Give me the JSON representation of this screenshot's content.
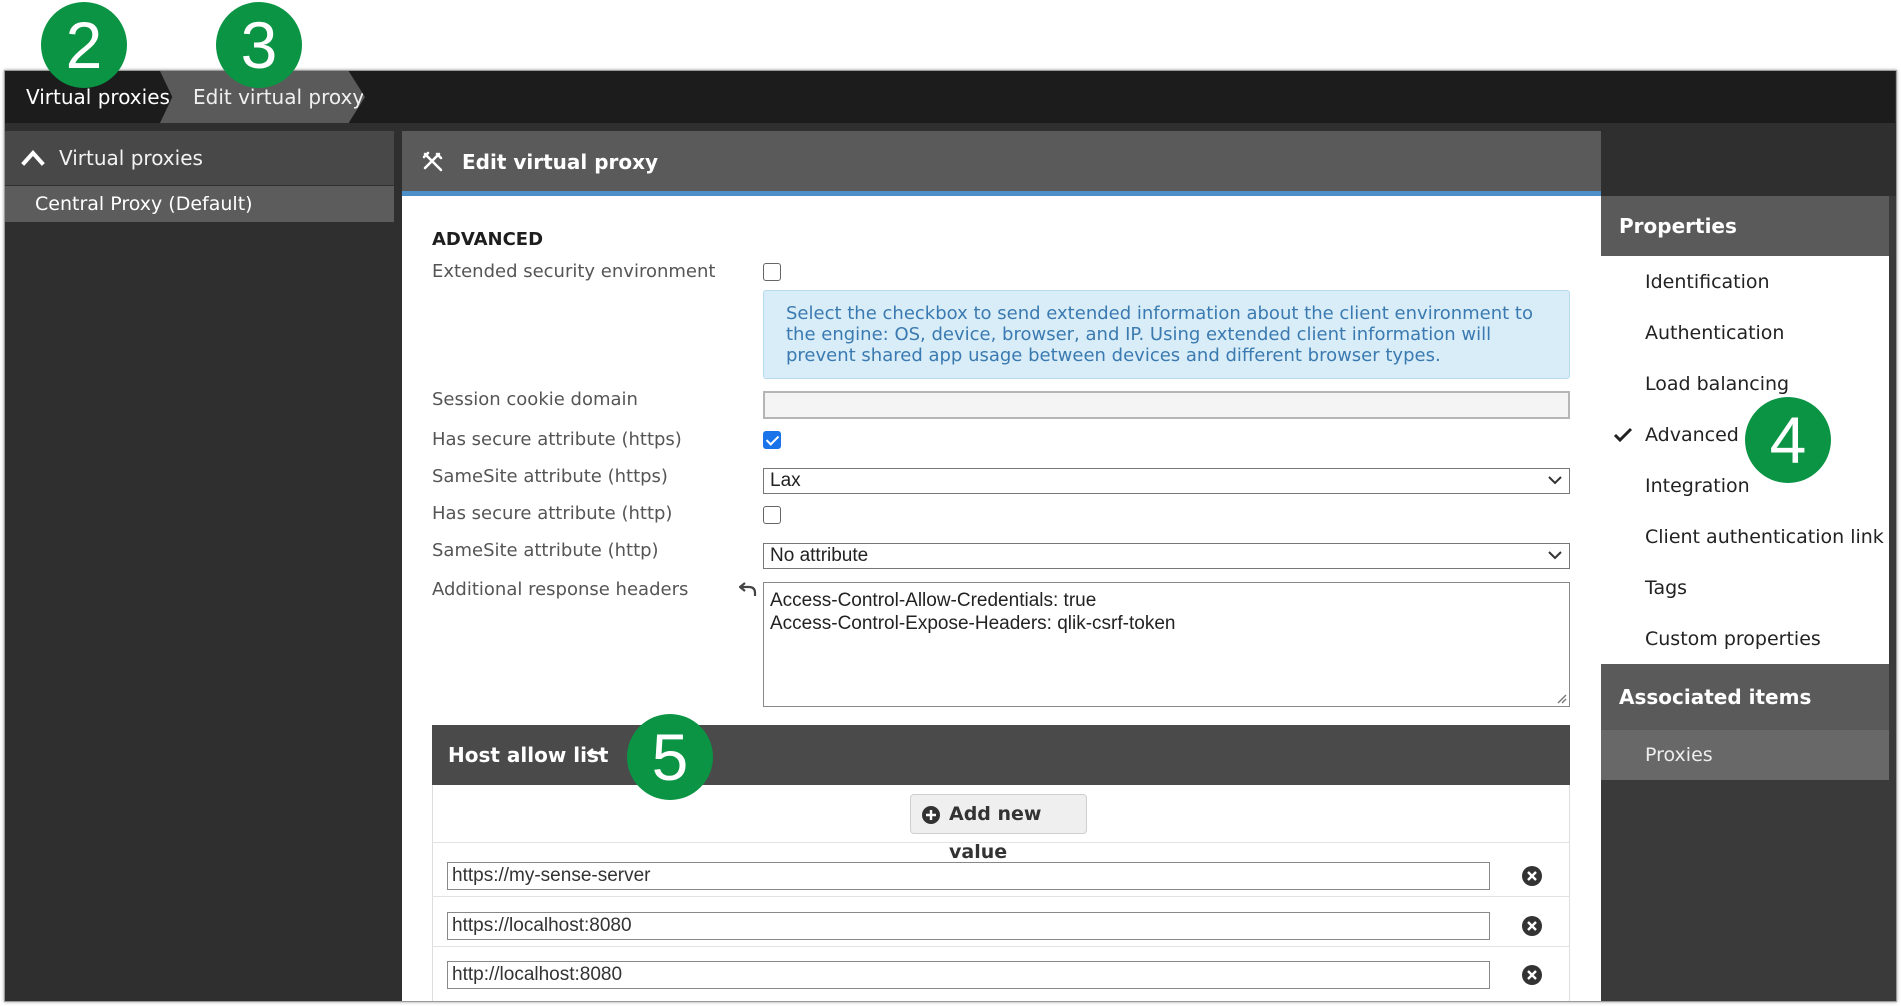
{
  "annotations": {
    "badge_2": "2",
    "badge_3": "3",
    "badge_4": "4",
    "badge_5": "5"
  },
  "breadcrumb": {
    "item1": "Virtual proxies",
    "item2": "Edit virtual proxy"
  },
  "sidebar": {
    "header": "Virtual proxies",
    "items": [
      "Central Proxy (Default)"
    ]
  },
  "main": {
    "title": "Edit virtual proxy",
    "section_title": "ADVANCED",
    "fields": {
      "extended_security_label": "Extended security environment",
      "extended_security_checked": false,
      "extended_security_help": "Select the checkbox to send extended information about the client environment to the engine: OS, device, browser, and IP. Using extended client information will prevent shared app usage between devices and different browser types.",
      "session_cookie_domain_label": "Session cookie domain",
      "session_cookie_domain_value": "",
      "has_secure_https_label": "Has secure attribute (https)",
      "has_secure_https_checked": true,
      "samesite_https_label": "SameSite attribute (https)",
      "samesite_https_value": "Lax",
      "has_secure_http_label": "Has secure attribute (http)",
      "has_secure_http_checked": false,
      "samesite_http_label": "SameSite attribute (http)",
      "samesite_http_value": "No attribute",
      "additional_headers_label": "Additional response headers",
      "additional_headers_value": "Access-Control-Allow-Credentials: true\nAccess-Control-Expose-Headers: qlik-csrf-token"
    },
    "host_allow_list": {
      "title": "Host allow list",
      "add_button": "Add new value",
      "entries": [
        "https://my-sense-server",
        "https://localhost:8080",
        "http://localhost:8080"
      ]
    }
  },
  "properties": {
    "header": "Properties",
    "items": [
      "Identification",
      "Authentication",
      "Load balancing",
      "Advanced",
      "Integration",
      "Client authentication link",
      "Tags",
      "Custom properties"
    ],
    "selected": "Advanced"
  },
  "associated": {
    "header": "Associated items",
    "items": [
      "Proxies"
    ]
  },
  "colors": {
    "accent_blue": "#4d8fc7",
    "badge_green": "#0a9444",
    "checkbox_blue": "#1a73e8",
    "info_bg": "#d8edf8",
    "info_text": "#3b7ab0"
  }
}
